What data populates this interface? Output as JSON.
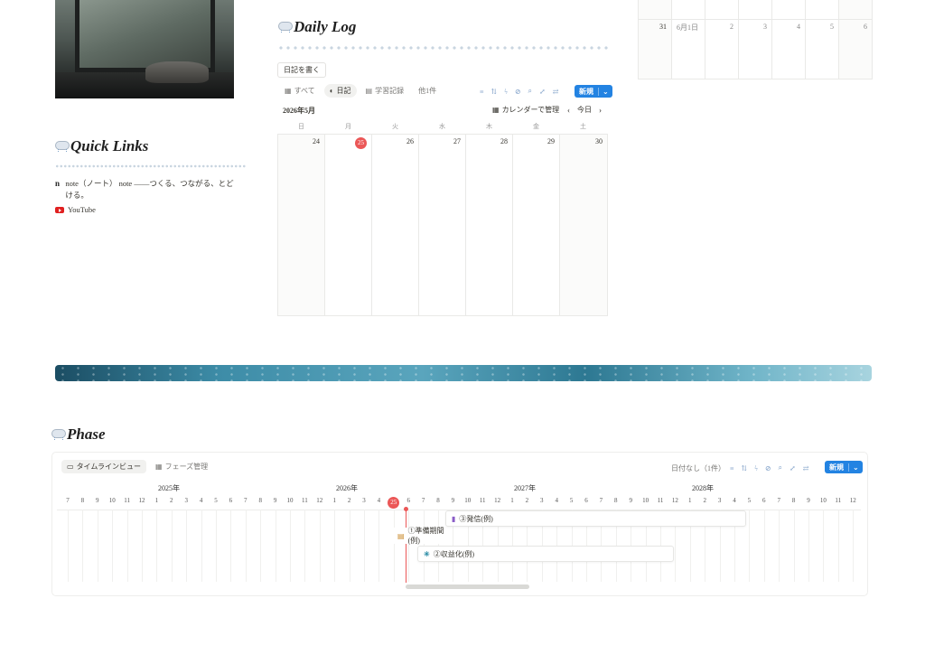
{
  "sidebar": {
    "quick_links_title": "Quick Links",
    "links": [
      {
        "icon": "note-icon",
        "label": "note（ノート） note ――つくる、つながる、とどける。"
      },
      {
        "icon": "youtube-icon",
        "label": "YouTube"
      }
    ]
  },
  "daily_log": {
    "title": "Daily Log",
    "write_button": "日記を書く",
    "tabs": [
      "すべて",
      "日記",
      "学習記録",
      "他1件"
    ],
    "new_label": "新規",
    "month_label": "2026年5月",
    "manage_label": "カレンダーで管理",
    "today_label": "今日",
    "weekdays": [
      "日",
      "月",
      "火",
      "水",
      "木",
      "金",
      "土"
    ],
    "days": [
      "24",
      "25",
      "26",
      "27",
      "28",
      "29",
      "30"
    ],
    "today_day": "25"
  },
  "top_right_calendar": {
    "days": [
      "31",
      "6月1日",
      "2",
      "3",
      "4",
      "5",
      "6"
    ]
  },
  "phase": {
    "title": "Phase",
    "tabs": [
      "タイムラインビュー",
      "フェーズ管理"
    ],
    "no_date": "日付なし（1件）",
    "new_label": "新規",
    "years": [
      "2025年",
      "2026年",
      "2027年",
      "2028年"
    ],
    "months": [
      "7",
      "8",
      "9",
      "10",
      "11",
      "12",
      "1",
      "2",
      "3",
      "4",
      "5",
      "6",
      "7",
      "8",
      "9",
      "10",
      "11",
      "12",
      "1",
      "2",
      "3",
      "4",
      "5",
      "6",
      "7",
      "8",
      "9",
      "10",
      "11",
      "12",
      "1",
      "2",
      "3",
      "4",
      "5",
      "6",
      "7",
      "8",
      "9",
      "10",
      "11",
      "12",
      "1",
      "2",
      "3",
      "4",
      "5",
      "6",
      "7",
      "8",
      "9",
      "10",
      "11",
      "12"
    ],
    "today_month": "25",
    "bars": [
      {
        "label": "③発信(例)",
        "icon": "phone-icon"
      },
      {
        "label": "①準備期間(例)",
        "icon": "book-icon"
      },
      {
        "label": "②収益化(例)",
        "icon": "asterisk-icon"
      }
    ]
  }
}
